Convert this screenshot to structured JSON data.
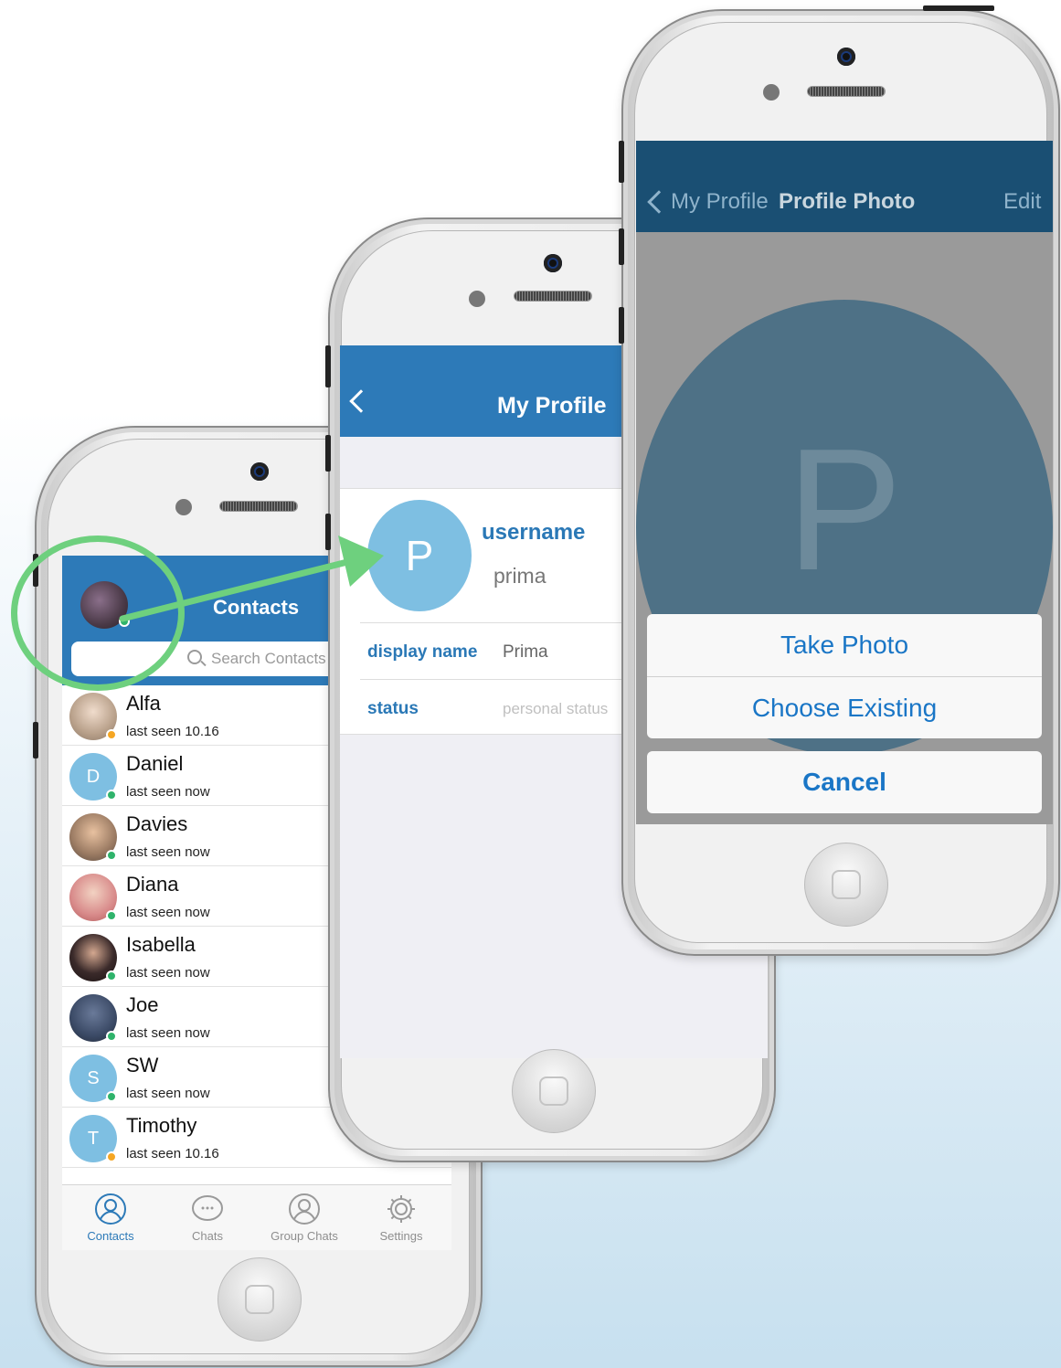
{
  "contacts_screen": {
    "title": "Contacts",
    "search_placeholder": "Search Contacts",
    "contacts": [
      {
        "name": "Alfa",
        "last_seen": "last seen 10.16",
        "status_color": "#f5a623",
        "avatar_letter": "",
        "avatar_color": "#c9b9aa"
      },
      {
        "name": "Daniel",
        "last_seen": "last seen now",
        "status_color": "#2fb36b",
        "avatar_letter": "D",
        "avatar_color": "#7ebfe2"
      },
      {
        "name": "Davies",
        "last_seen": "last seen now",
        "status_color": "#2fb36b",
        "avatar_letter": "",
        "avatar_color": "#9a7a62"
      },
      {
        "name": "Diana",
        "last_seen": "last seen now",
        "status_color": "#2fb36b",
        "avatar_letter": "",
        "avatar_color": "#c58a8a"
      },
      {
        "name": "Isabella",
        "last_seen": "last seen now",
        "status_color": "#2fb36b",
        "avatar_letter": "",
        "avatar_color": "#3a2a2a"
      },
      {
        "name": "Joe",
        "last_seen": "last seen now",
        "status_color": "#2fb36b",
        "avatar_letter": "",
        "avatar_color": "#3b4a66"
      },
      {
        "name": "SW",
        "last_seen": "last seen now",
        "status_color": "#2fb36b",
        "avatar_letter": "S",
        "avatar_color": "#7ebfe2"
      },
      {
        "name": "Timothy",
        "last_seen": "last seen 10.16",
        "status_color": "#f5a623",
        "avatar_letter": "T",
        "avatar_color": "#7ebfe2"
      }
    ],
    "tabs": [
      {
        "label": "Contacts",
        "icon": "person-icon",
        "active": true
      },
      {
        "label": "Chats",
        "icon": "chat-bubble-icon",
        "active": false
      },
      {
        "label": "Group Chats",
        "icon": "group-icon",
        "active": false
      },
      {
        "label": "Settings",
        "icon": "gear-icon",
        "active": false
      }
    ]
  },
  "profile_screen": {
    "title": "My Profile",
    "avatar_letter": "P",
    "username_label": "username",
    "username_value": "prima",
    "display_name_label": "display name",
    "display_name_value": "Prima",
    "status_label": "status",
    "status_placeholder": "personal status"
  },
  "photo_screen": {
    "back_label": "My Profile",
    "title": "Profile Photo",
    "edit_label": "Edit",
    "avatar_letter": "P",
    "take_photo": "Take Photo",
    "choose_existing": "Choose Existing",
    "cancel": "Cancel"
  },
  "colors": {
    "accent": "#2d7ab8",
    "highlight": "#6ed07e"
  }
}
